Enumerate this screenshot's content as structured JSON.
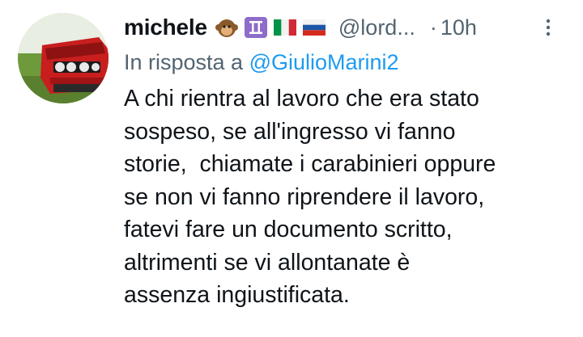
{
  "tweet": {
    "author": {
      "display_name": "michele",
      "badges": [
        "monkey-emoji",
        "gemini-emoji",
        "italy-flag-emoji",
        "russia-flag-emoji"
      ],
      "handle": "@lord...",
      "avatar": "red-car-avatar"
    },
    "separator": "·",
    "time": "10h",
    "more_icon": "more-vertical-icon",
    "reply_prefix": "In risposta a",
    "reply_to": "@GiulioMarini2",
    "text": "A chi rientra al lavoro che era stato\nsospeso, se all'ingresso vi fanno\nstorie,  chiamate i carabinieri oppure\nse non vi fanno riprendere il lavoro,\nfatevi fare un documento scritto,\naltrimenti se vi allontanate è\nassenza ingiustificata."
  },
  "colors": {
    "text_primary": "#0f1419",
    "text_secondary": "#536471",
    "accent": "#1d9bf0"
  }
}
